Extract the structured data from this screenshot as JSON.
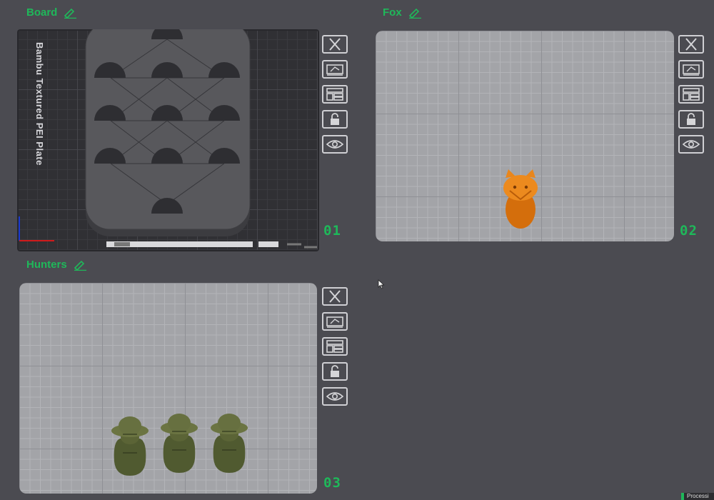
{
  "plates": [
    {
      "title": "Board",
      "number": "01",
      "bed_label": "Bambu Textured PEI Plate",
      "theme": "dark"
    },
    {
      "title": "Fox",
      "number": "02",
      "theme": "light"
    },
    {
      "title": "Hunters",
      "number": "03",
      "theme": "light"
    }
  ],
  "tools": [
    "close-icon",
    "auto-orient-icon",
    "arrange-icon",
    "lock-icon",
    "preview-eye-icon"
  ],
  "colors": {
    "accent": "#1fb85a",
    "fox": "#e07a10",
    "hunter": "#5b6436",
    "board": "#545458"
  },
  "status_text": "Processi"
}
